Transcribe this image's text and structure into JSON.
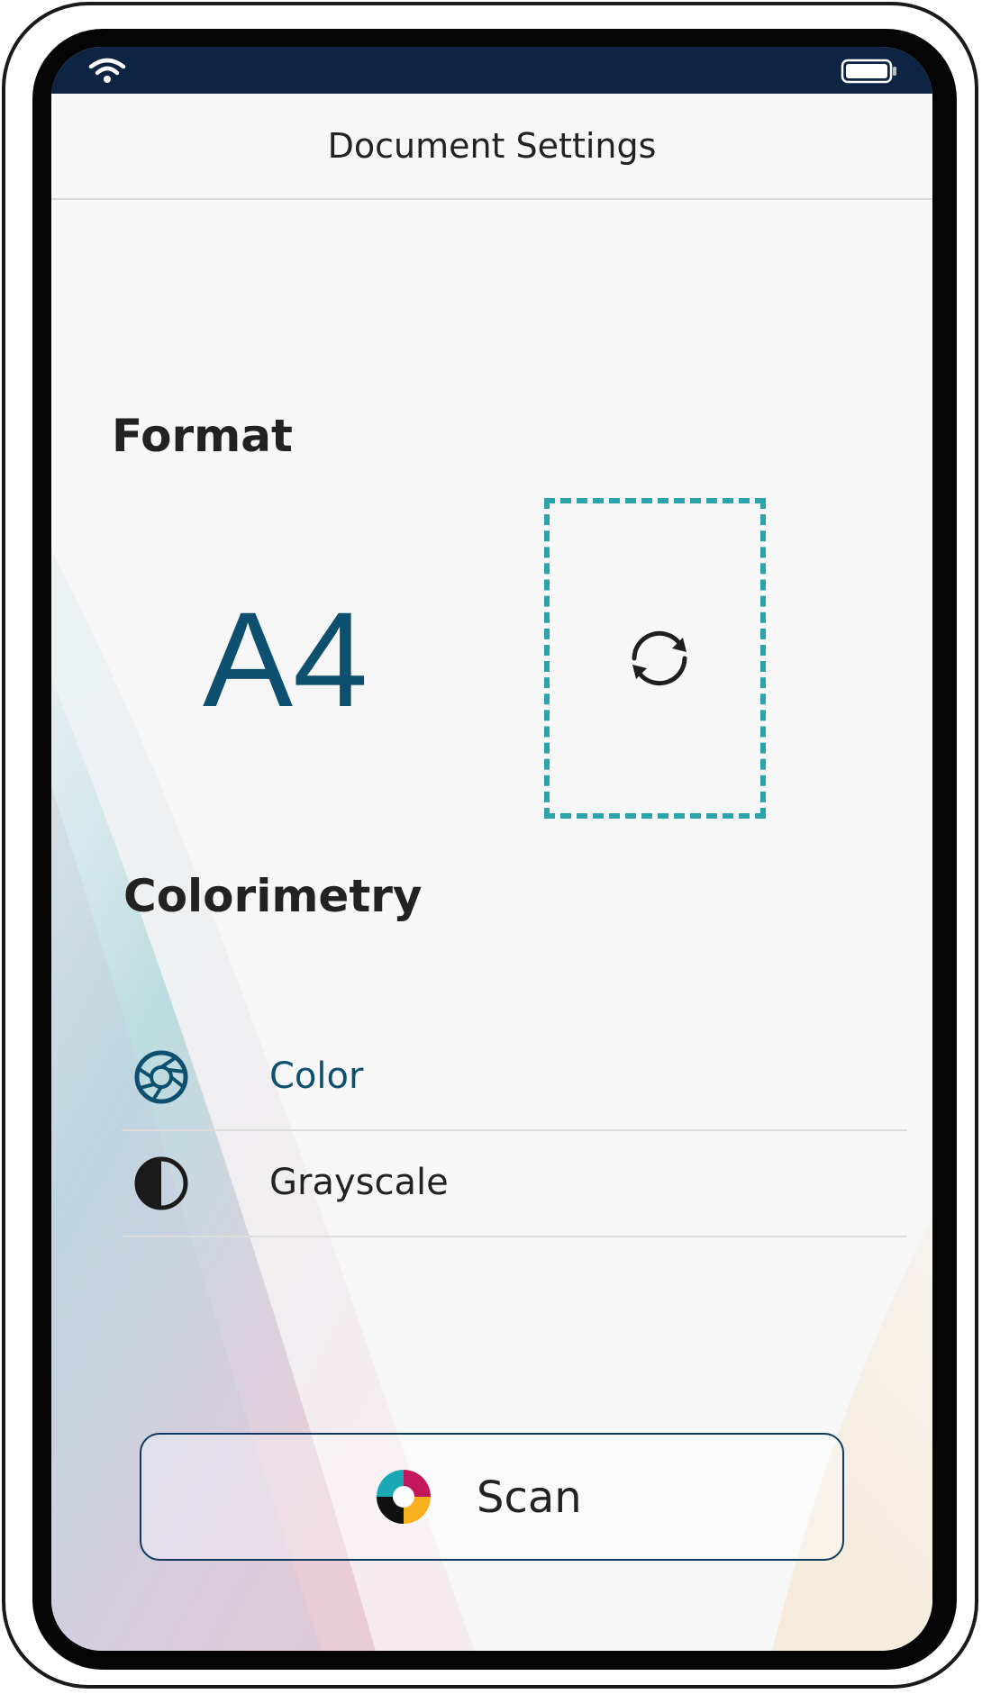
{
  "nav": {
    "title": "Document Settings"
  },
  "status_bar": {
    "wifi_icon": "wifi-icon",
    "battery_icon": "battery-icon"
  },
  "format": {
    "section_title": "Format",
    "value": "A4",
    "rotate_icon": "rotate-icon"
  },
  "colorimetry": {
    "section_title": "Colorimetry",
    "options": [
      {
        "label": "Color",
        "icon": "aperture-icon",
        "selected": true
      },
      {
        "label": "Grayscale",
        "icon": "half-circle-icon",
        "selected": false
      }
    ]
  },
  "scan_button": {
    "label": "Scan",
    "icon": "scan-logo-icon"
  },
  "colors": {
    "accent": "#0d4f6e",
    "dashed_border": "#2aa3ad",
    "status_bar": "#0d2443",
    "text": "#222222"
  }
}
